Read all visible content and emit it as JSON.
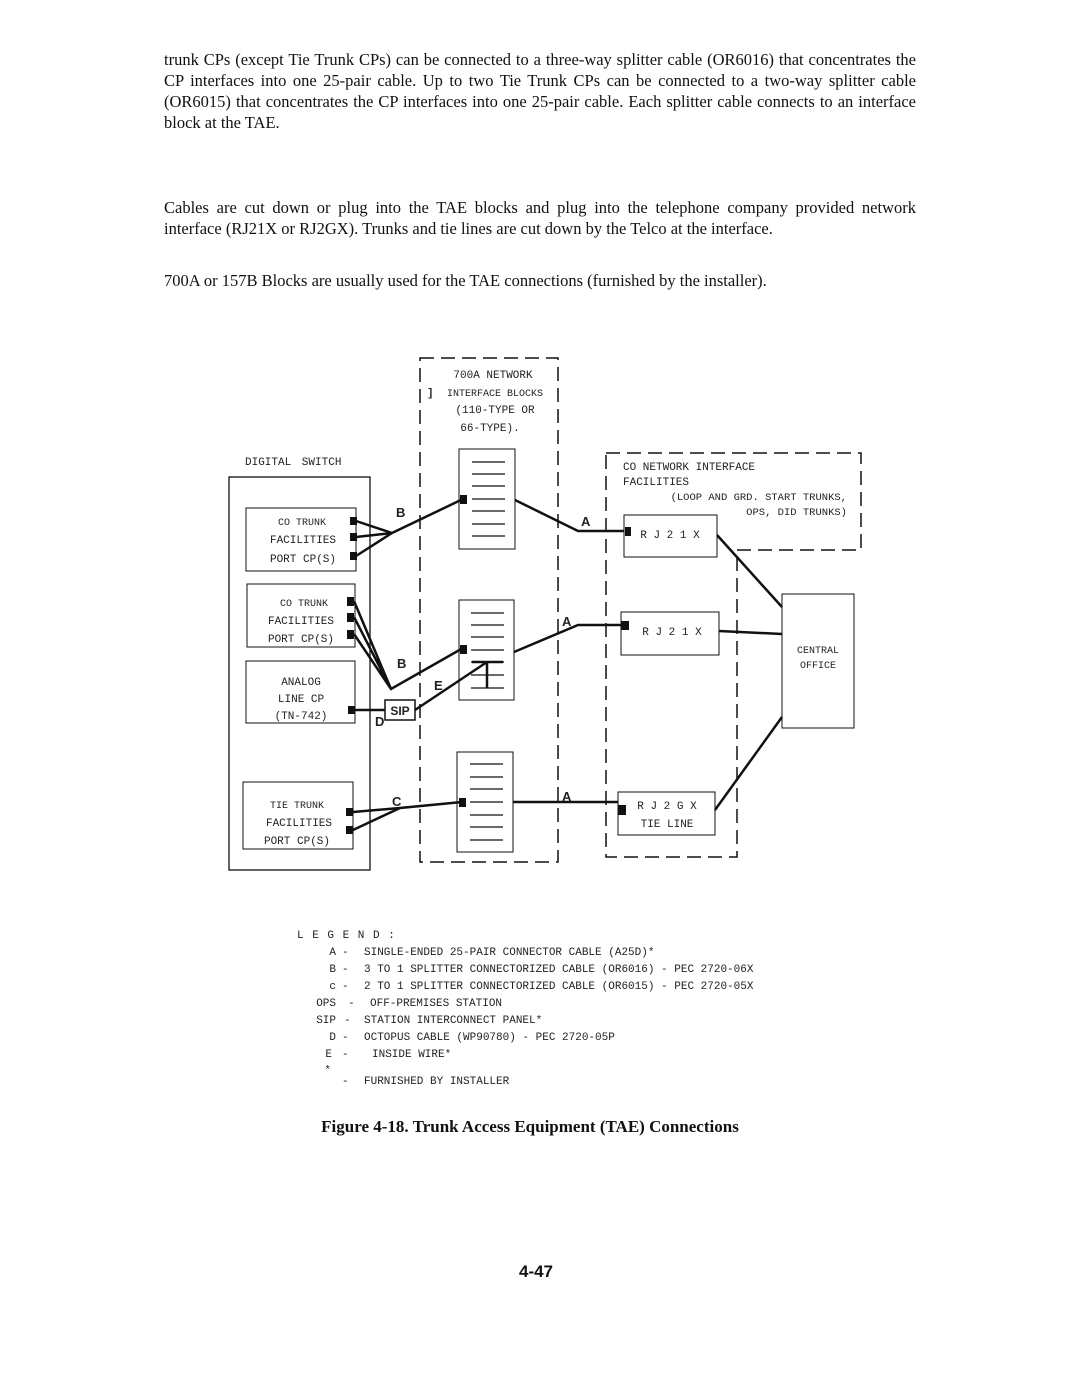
{
  "body": {
    "paragraphs": [
      "trunk CPs (except Tie Trunk CPs) can be connected to a three-way splitter cable (OR6016) that concentrates the CP interfaces into one 25-pair cable. Up to two Tie Trunk CPs can be connected to a two-way splitter cable (OR6015) that concentrates the CP interfaces into one 25-pair cable. Each splitter cable connects to an interface block at the TAE.",
      "Cables are cut down or plug into the TAE blocks and plug into the telephone company provided network interface (RJ21X or RJ2GX). Trunks and tie lines are cut down by the Telco at the interface.",
      "700A or 157B Blocks are usually used for the TAE connections (furnished by the installer)."
    ]
  },
  "diagram": {
    "blocks_title": [
      "700A NETWORK",
      "INTERFACE BLOCKS",
      "(110-TYPE OR",
      "66-TYPE)."
    ],
    "blocks_bracket": "]",
    "switch_title": "DIGITAL SWITCH",
    "co_trunk_1": [
      "CO TRUNK",
      "FACILITIES",
      "PORT CP(S)"
    ],
    "co_trunk_2": [
      "CO TRUNK",
      "FACILITIES",
      "PORT CP(S)"
    ],
    "analog": [
      "ANALOG",
      "LINE CP",
      "(TN-742)"
    ],
    "tie_trunk": [
      "TIE TRUNK",
      "FACILITIES",
      "PORT CP(S)"
    ],
    "sip": "SIP",
    "cable_labels": {
      "a": "A",
      "b": "B",
      "c": "C",
      "d": "D",
      "e": "E"
    },
    "co_network": [
      "CO NETWORK INTERFACE",
      "FACILITIES",
      "(LOOP AND GRD. START TRUNKS,",
      "OPS, DID TRUNKS)"
    ],
    "rj21x_1": "R J 2 1 X",
    "rj21x_2": "R J 2 1 X",
    "rj2gx": [
      "R J 2 G X",
      "TIE LINE"
    ],
    "central_office": [
      "CENTRAL",
      "OFFICE"
    ]
  },
  "legend": {
    "title": "L E G E N D :",
    "items": [
      {
        "key": "A",
        "text": "SINGLE-ENDED 25-PAIR CONNECTOR CABLE (A25D)*"
      },
      {
        "key": "B",
        "text": "3 TO 1 SPLITTER CONNECTORIZED CABLE (OR6016) - PEC 2720-06X"
      },
      {
        "key": "c",
        "text": "2 TO 1 SPLITTER CONNECTORIZED CABLE (OR6015) - PEC 2720-05X"
      },
      {
        "key": "OPS",
        "text": "OFF-PREMISES STATION"
      },
      {
        "key": "SIP",
        "text": "STATION INTERCONNECT PANEL*"
      },
      {
        "key": "D",
        "text": "OCTOPUS CABLE (WP90780) - PEC 2720-05P"
      },
      {
        "key": "E",
        "text": "INSIDE WIRE*"
      },
      {
        "key": "*",
        "text": "FURNISHED BY INSTALLER"
      }
    ]
  },
  "caption": "Figure 4-18. Trunk Access Equipment (TAE) Connections",
  "page_number": "4-47"
}
